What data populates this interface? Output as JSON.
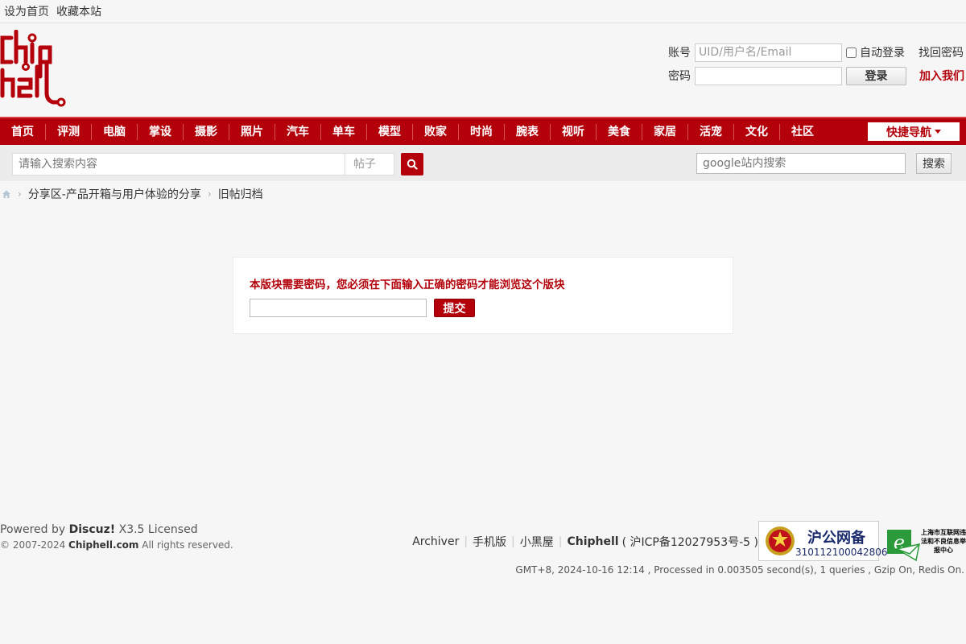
{
  "topbar": {
    "set_home": "设为首页",
    "bookmark": "收藏本站"
  },
  "login": {
    "account_label": "账号",
    "account_placeholder": "UID/用户名/Email",
    "auto_login": "自动登录",
    "forgot": "找回密码",
    "password_label": "密码",
    "login_button": "登录",
    "join": "加入我们"
  },
  "nav": {
    "items": [
      "首页",
      "评测",
      "电脑",
      "掌设",
      "摄影",
      "照片",
      "汽车",
      "单车",
      "模型",
      "败家",
      "时尚",
      "腕表",
      "视听",
      "美食",
      "家居",
      "活宠",
      "文化",
      "社区"
    ],
    "quick": "快捷导航"
  },
  "search": {
    "placeholder": "请输入搜索内容",
    "type": "帖子",
    "google_placeholder": "google站内搜索",
    "google_button": "搜索"
  },
  "breadcrumb": {
    "item1": "分享区-产品开箱与用户体验的分享",
    "item2": "旧帖归档"
  },
  "panel": {
    "message": "本版块需要密码，您必须在下面输入正确的密码才能浏览这个版块",
    "submit": "提交"
  },
  "footer": {
    "powered_prefix": "Powered by ",
    "powered_brand": "Discuz!",
    "powered_suffix": " X3.5 Licensed",
    "copy_prefix": "© 2007-2024 ",
    "copy_brand": "Chiphell.com",
    "copy_suffix": " All rights reserved.",
    "links": {
      "archiver": "Archiver",
      "mobile": "手机版",
      "blackroom": "小黑屋",
      "site": "Chiphell",
      "icp": "( 沪ICP备12027953号-5 )"
    },
    "badge1_title": "沪公网备",
    "badge1_number": "310112100042806",
    "badge2_text": "上海市互联网违法和不良信息举报中心",
    "gmt": "GMT+8, 2024-10-16 12:14 , Processed in 0.003505 second(s), 1 queries , Gzip On, Redis On."
  },
  "colors": {
    "brand_red": "#b3000a"
  }
}
